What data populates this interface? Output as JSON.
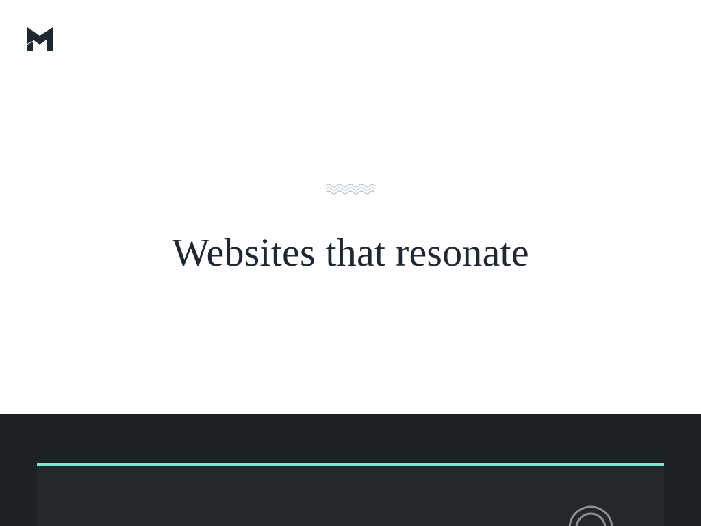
{
  "brand": {
    "logo_icon": "m-logo-icon",
    "logo_color": "#1f2830"
  },
  "hero": {
    "ornament_icon": "wave-ornament-icon",
    "headline": "Websites that resonate",
    "text_color": "#1f2830",
    "background": "#ffffff"
  },
  "showcase": {
    "background": "#1f2224",
    "card_background": "#25282a",
    "accent_color": "#7fe3cf",
    "badge_icon": "ring-icon"
  }
}
